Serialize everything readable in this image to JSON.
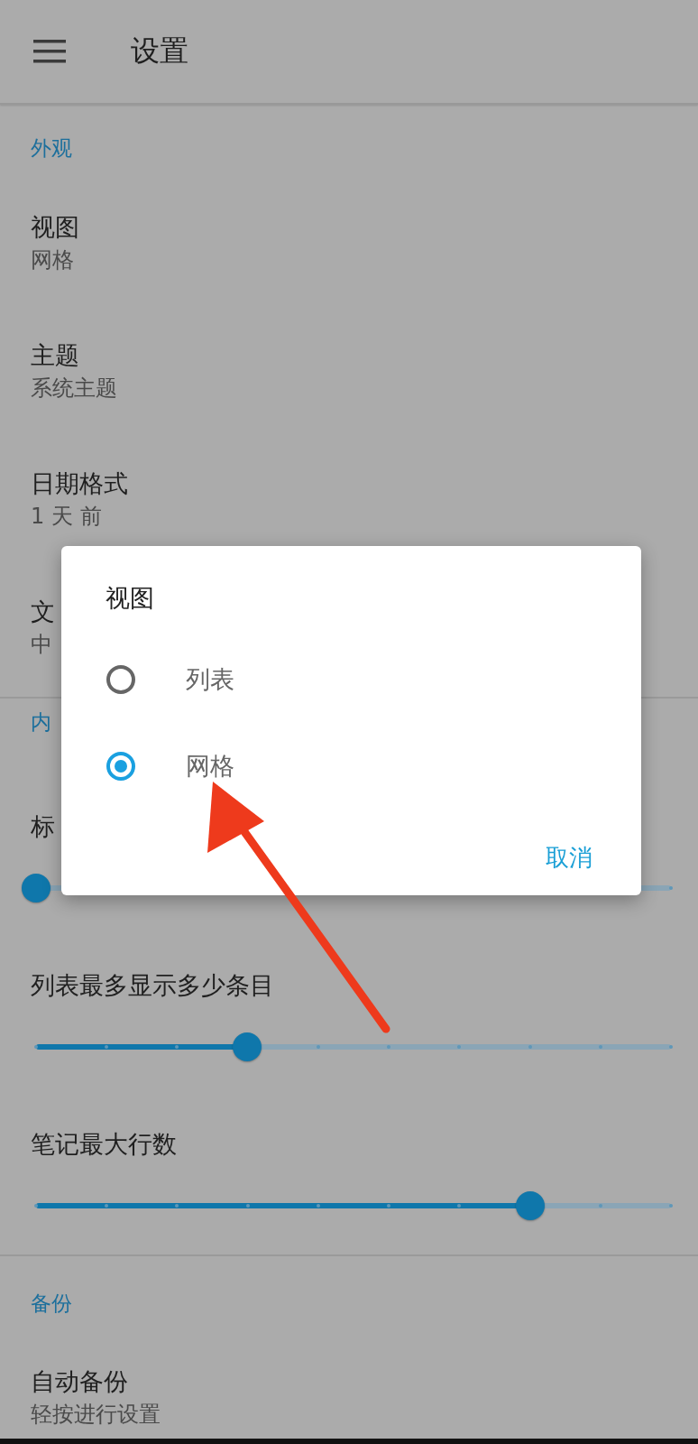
{
  "app_bar": {
    "title": "设置"
  },
  "sections": [
    {
      "header": "外观",
      "items": [
        {
          "kind": "text",
          "title": "视图",
          "summary": "网格"
        },
        {
          "kind": "text",
          "title": "主题",
          "summary": "系统主题"
        },
        {
          "kind": "text",
          "title": "日期格式",
          "summary": "1 天 前"
        },
        {
          "kind": "text",
          "title": "文",
          "summary": "中"
        }
      ]
    },
    {
      "header": "内",
      "items": [
        {
          "kind": "slider",
          "title": "标",
          "level": 0
        },
        {
          "kind": "slider",
          "title": "列表最多显示多少条目",
          "level": 0.333
        },
        {
          "kind": "slider",
          "title": "笔记最大行数",
          "level": 0.778
        }
      ]
    },
    {
      "header": "备份",
      "items": [
        {
          "kind": "text",
          "title": "自动备份",
          "summary": "轻按进行设置"
        }
      ]
    }
  ],
  "dialog": {
    "title": "视图",
    "options": [
      {
        "label": "列表",
        "selected": false
      },
      {
        "label": "网格",
        "selected": true
      }
    ],
    "buttons": [
      "取消"
    ]
  }
}
